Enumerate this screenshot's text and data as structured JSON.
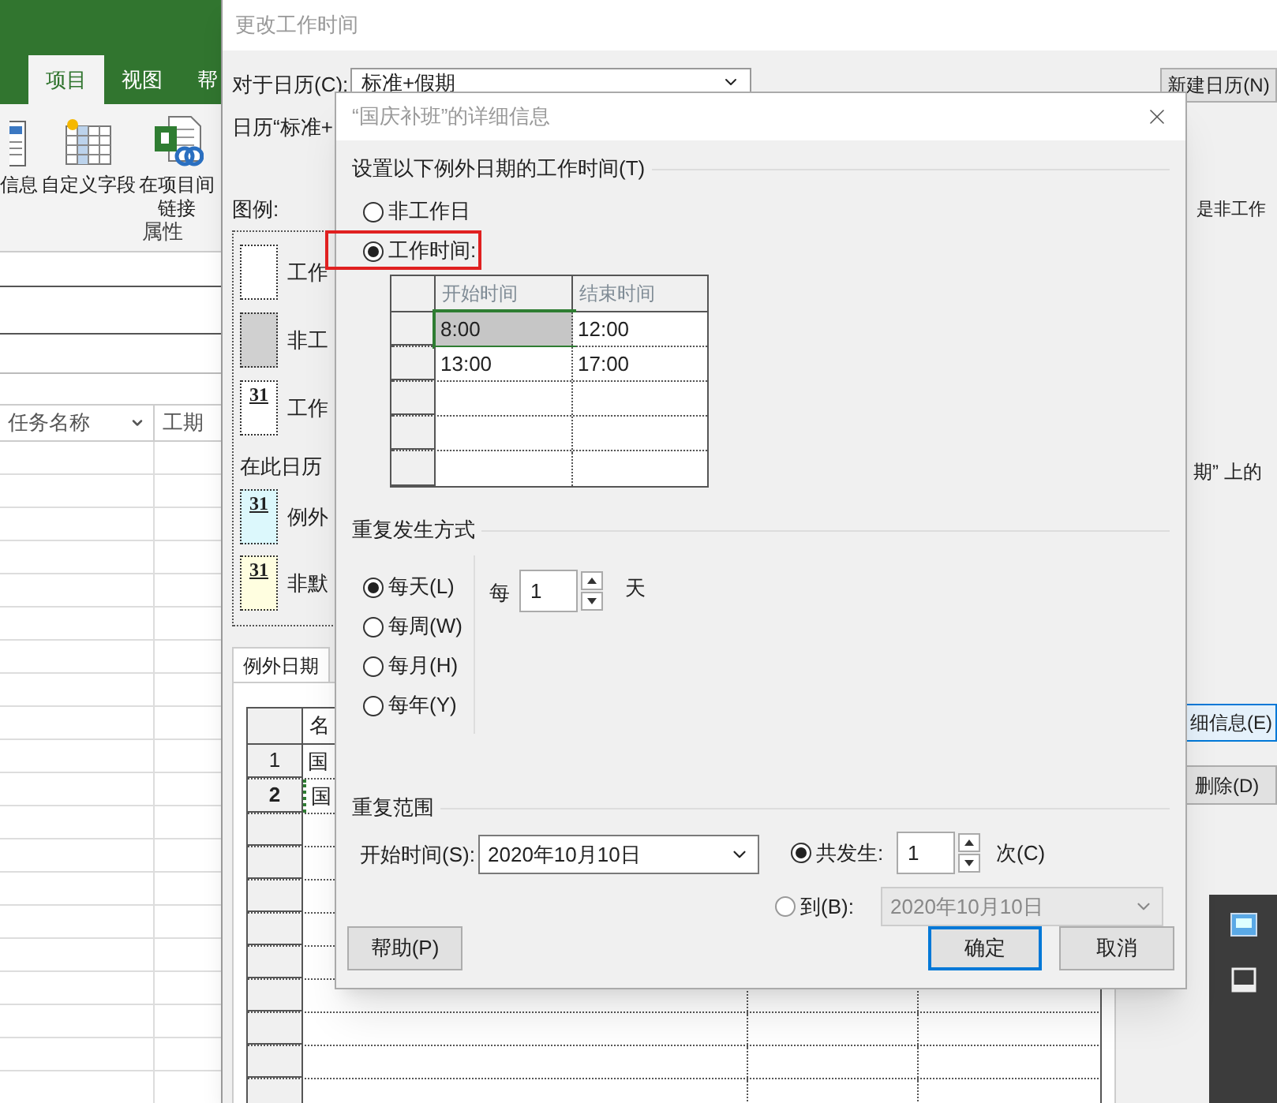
{
  "app": {
    "ribbon_tabs": [
      {
        "label": "项目",
        "selected": true
      },
      {
        "label": "视图",
        "selected": false
      },
      {
        "label": "帮",
        "selected": false
      }
    ],
    "commands": [
      {
        "kind": "info",
        "lines": [
          "信息"
        ]
      },
      {
        "kind": "fields",
        "lines": [
          "自定义字段"
        ]
      },
      {
        "kind": "link",
        "lines": [
          "在项目间",
          "链接"
        ]
      }
    ],
    "group_label": "属性",
    "task_columns": [
      "任务名称",
      "工期"
    ]
  },
  "calendar_dialog": {
    "title": "更改工作时间",
    "for_calendar_label": "对于日历(C):",
    "calendar_value": "标准+假期",
    "new_calendar_button": "新建日历(N)",
    "calendar_note": "日历“标准+",
    "legend_label": "图例:",
    "legend_items": [
      {
        "color": "#ffffff",
        "label": "工作"
      },
      {
        "color": "#d0d0d0",
        "label": "非工"
      },
      {
        "color": "#ffffff",
        "date_mark": "31",
        "label": "工作"
      }
    ],
    "legend_note": "在此日历",
    "legend_items_2": [
      {
        "color": "#dcf8fc",
        "date_mark": "31",
        "label": "例外"
      },
      {
        "color": "#fffee0",
        "date_mark": "31",
        "label": "非默"
      }
    ],
    "right_note_1": "是非工作",
    "right_note_2": "期” 上的",
    "tabs": [
      {
        "label": "例外日期",
        "selected": true
      }
    ],
    "exceptions_header": "名",
    "exceptions": [
      {
        "index": "1",
        "name": "国",
        "selected": false
      },
      {
        "index": "2",
        "name": "国",
        "selected": true
      }
    ],
    "details_button": "细信息(E)",
    "delete_button": "删除(D)"
  },
  "detail_dialog": {
    "title": "“国庆补班”的详细信息",
    "section_title": "设置以下例外日期的工作时间(T)",
    "day_types": [
      {
        "label": "非工作日",
        "selected": false,
        "highlighted": false
      },
      {
        "label": "工作时间:",
        "selected": true,
        "highlighted": true
      }
    ],
    "time_columns": [
      "开始时间",
      "结束时间"
    ],
    "time_rows": [
      {
        "start": "8:00",
        "end": "12:00",
        "selected": true
      },
      {
        "start": "13:00",
        "end": "17:00",
        "selected": false
      }
    ],
    "recurrence_title": "重复发生方式",
    "recurrence_options": [
      {
        "label": "每天(L)",
        "selected": true
      },
      {
        "label": "每周(W)",
        "selected": false
      },
      {
        "label": "每月(H)",
        "selected": false
      },
      {
        "label": "每年(Y)",
        "selected": false
      }
    ],
    "every_label": "每",
    "every_value": "1",
    "every_unit": "天",
    "range_title": "重复范围",
    "start_label": "开始时间(S):",
    "start_value": "2020年10月10日",
    "end_options": [
      {
        "kind": "count",
        "label": "共发生:",
        "selected": true,
        "value": "1",
        "unit": "次(C)"
      },
      {
        "kind": "date",
        "label": "到(B):",
        "selected": false,
        "disabled": true,
        "value": "2020年10月10日"
      }
    ],
    "help_button": "帮助(P)",
    "ok_button": "确定",
    "cancel_button": "取消"
  }
}
